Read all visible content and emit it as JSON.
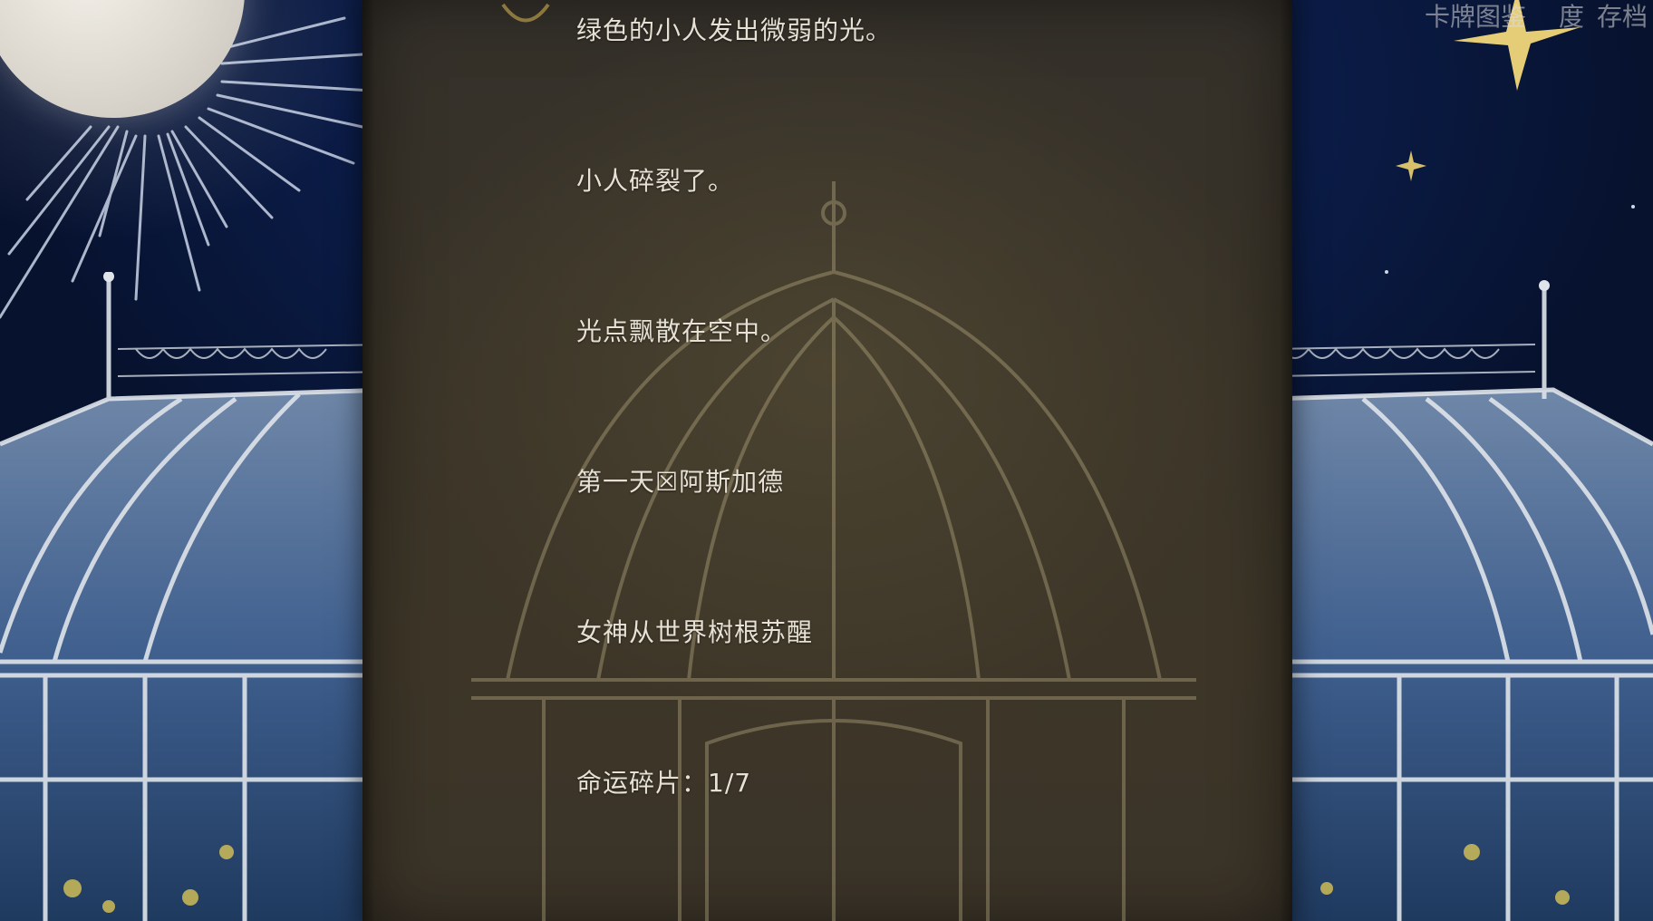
{
  "dialogue": {
    "lines": [
      "绿色的小人发出微弱的光。",
      "小人碎裂了。",
      "光点飘散在空中。",
      "第一天☒阿斯加德",
      "女神从世界树根苏醒",
      "命运碎片：1/7"
    ]
  },
  "top_menu": {
    "card_gallery": "卡牌图鉴",
    "difficulty": "难度",
    "difficulty_visible": "度",
    "save": "存档"
  },
  "colors": {
    "sky": "#0c1f4f",
    "parchment": "#3a3428",
    "text": "#e6e1d4"
  }
}
